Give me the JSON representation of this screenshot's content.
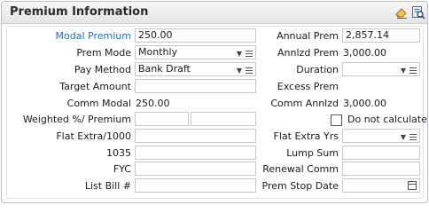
{
  "panel": {
    "title": "Premium Information",
    "icons": [
      "eraser-icon",
      "search-document-icon"
    ]
  },
  "left": {
    "modal_premium": {
      "label": "Modal Premium",
      "value": "250.00"
    },
    "prem_mode": {
      "label": "Prem Mode",
      "value": "Monthly"
    },
    "pay_method": {
      "label": "Pay Method",
      "value": "Bank Draft"
    },
    "target_amount": {
      "label": "Target Amount",
      "value": ""
    },
    "comm_modal": {
      "label": "Comm Modal",
      "value": "250.00"
    },
    "weighted_premium": {
      "label": "Weighted %/ Premium",
      "value1": "",
      "value2": ""
    },
    "flat_extra": {
      "label": "Flat Extra/1000",
      "value": ""
    },
    "f1035": {
      "label": "1035",
      "value": ""
    },
    "fyc": {
      "label": "FYC",
      "value": ""
    },
    "list_bill": {
      "label": "List Bill #",
      "value": ""
    }
  },
  "right": {
    "annual_prem": {
      "label": "Annual Prem",
      "value": "2,857.14"
    },
    "annlzd_prem": {
      "label": "Annlzd Prem",
      "value": "3,000.00"
    },
    "duration": {
      "label": "Duration",
      "value": ""
    },
    "excess_prem": {
      "label": "Excess Prem",
      "value": ""
    },
    "comm_annlzd": {
      "label": "Comm Annlzd",
      "value": "3,000.00"
    },
    "do_not_calculate": {
      "label": "Do not calculate",
      "checked": false
    },
    "flat_extra_yrs": {
      "label": "Flat Extra Yrs",
      "value": ""
    },
    "lump_sum": {
      "label": "Lump Sum",
      "value": ""
    },
    "renewal_comm": {
      "label": "Renewal Comm",
      "value": ""
    },
    "prem_stop_date": {
      "label": "Prem Stop Date",
      "value": ""
    }
  }
}
